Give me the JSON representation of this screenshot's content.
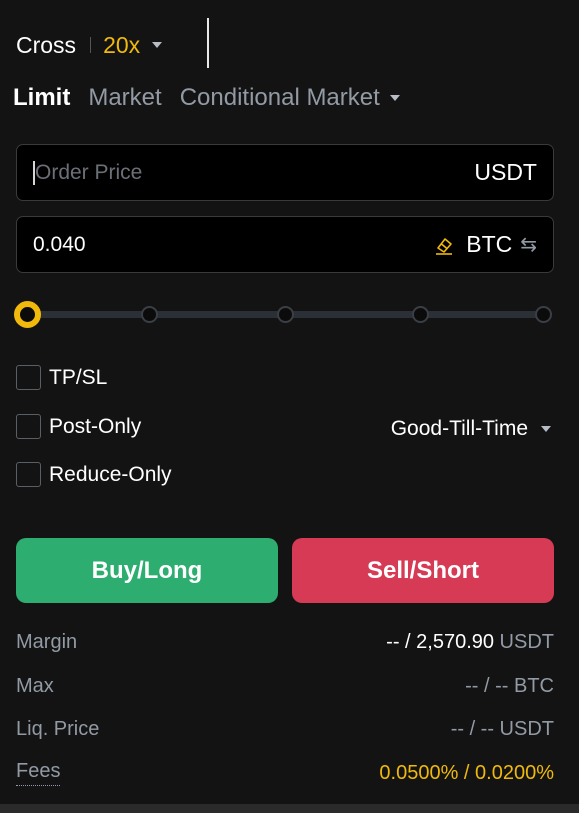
{
  "header": {
    "margin_mode": "Cross",
    "leverage": "20x"
  },
  "tabs": [
    {
      "label": "Limit",
      "active": true
    },
    {
      "label": "Market",
      "active": false
    },
    {
      "label": "Conditional Market",
      "active": false
    }
  ],
  "price_input": {
    "placeholder": "Order Price",
    "value": "",
    "unit": "USDT"
  },
  "quantity_input": {
    "value": "0.040",
    "unit": "BTC",
    "swap_icon": "swap-arrows-icon",
    "clear_icon": "eraser-icon"
  },
  "slider": {
    "value_percent": 0,
    "stops": [
      0,
      25,
      50,
      75,
      100
    ]
  },
  "options": {
    "tpsl": {
      "label": "TP/SL",
      "checked": false
    },
    "post_only": {
      "label": "Post-Only",
      "checked": false
    },
    "reduce_only": {
      "label": "Reduce-Only",
      "checked": false
    },
    "time_in_force": "Good-Till-Time"
  },
  "buttons": {
    "buy": "Buy/Long",
    "sell": "Sell/Short"
  },
  "info": {
    "margin": {
      "label": "Margin",
      "value_main": "-- / 2,570.90",
      "unit": " USDT"
    },
    "max": {
      "label": "Max",
      "value": "-- / -- BTC"
    },
    "liq_price": {
      "label": "Liq. Price",
      "value": "-- / -- USDT"
    },
    "fees": {
      "label": "Fees",
      "value": "0.0500% / 0.0200%"
    }
  },
  "colors": {
    "accent": "#f0b90b",
    "buy": "#2ead71",
    "sell": "#d63a54",
    "background": "#131313",
    "muted_text": "#929aa5"
  }
}
